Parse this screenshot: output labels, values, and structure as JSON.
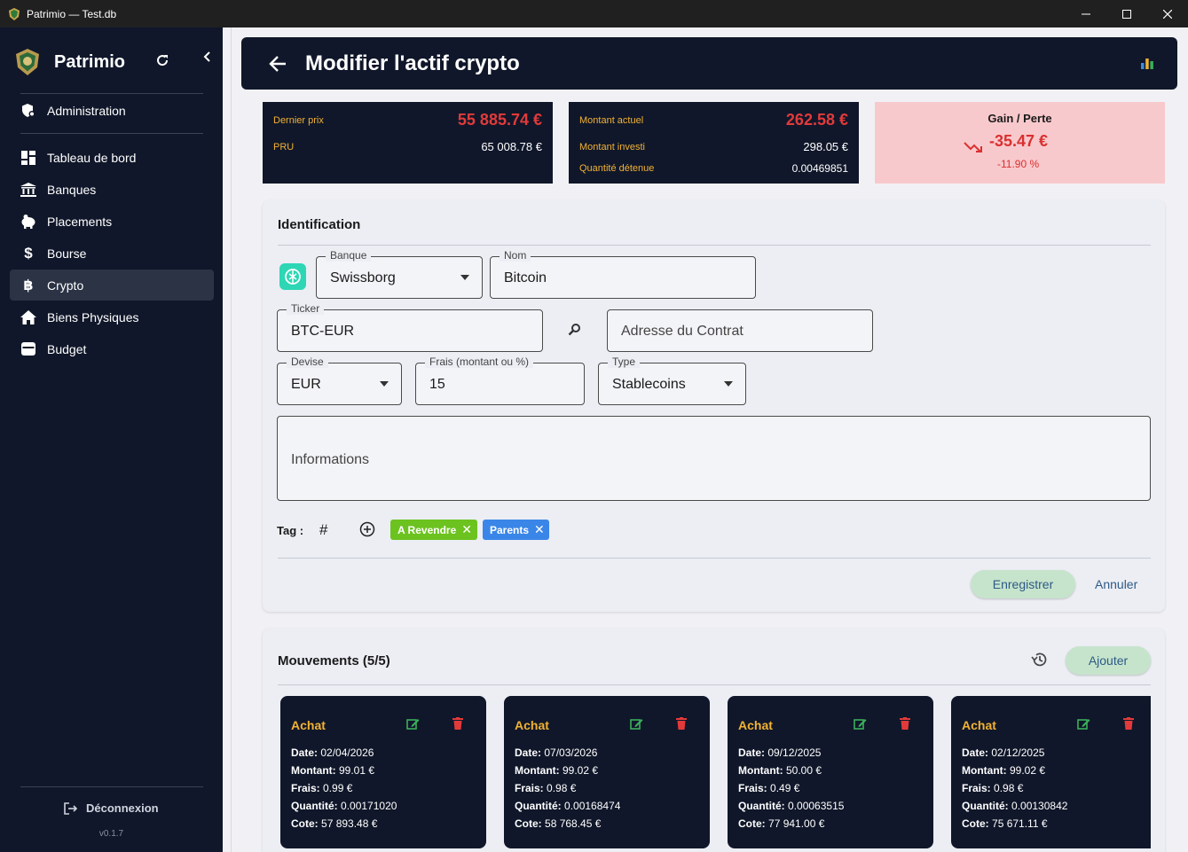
{
  "window": {
    "title": "Patrimio — Test.db"
  },
  "sidebar": {
    "brand": "Patrimio",
    "admin": "Administration",
    "items": [
      {
        "label": "Tableau de bord",
        "icon": "dashboard-icon"
      },
      {
        "label": "Banques",
        "icon": "bank-icon"
      },
      {
        "label": "Placements",
        "icon": "piggy-bank-icon"
      },
      {
        "label": "Bourse",
        "icon": "dollar-icon"
      },
      {
        "label": "Crypto",
        "icon": "bitcoin-icon",
        "active": true
      },
      {
        "label": "Biens Physiques",
        "icon": "home-icon"
      },
      {
        "label": "Budget",
        "icon": "wallet-icon"
      }
    ],
    "logout": "Déconnexion",
    "version": "v0.1.7"
  },
  "header": {
    "title": "Modifier l'actif crypto"
  },
  "stats": {
    "last_price_label": "Dernier prix",
    "last_price": "55 885.74 €",
    "pru_label": "PRU",
    "pru": "65 008.78 €",
    "current_label": "Montant actuel",
    "current": "262.58 €",
    "invested_label": "Montant investi",
    "invested": "298.05 €",
    "qty_label": "Quantité détenue",
    "qty": "0.00469851",
    "gain_title": "Gain / Perte",
    "gain_value": "-35.47 €",
    "gain_pct": "-11.90 %"
  },
  "identification": {
    "title": "Identification",
    "bank_label": "Banque",
    "bank_value": "Swissborg",
    "name_label": "Nom",
    "name_value": "Bitcoin",
    "ticker_label": "Ticker",
    "ticker_value": "BTC-EUR",
    "contract_placeholder": "Adresse du Contrat",
    "currency_label": "Devise",
    "currency_value": "EUR",
    "fees_label": "Frais (montant ou %)",
    "fees_value": "15",
    "type_label": "Type",
    "type_value": "Stablecoins",
    "info_placeholder": "Informations",
    "tag_label": "Tag :",
    "tags": [
      {
        "label": "A Revendre",
        "color": "#6cc21f"
      },
      {
        "label": "Parents",
        "color": "#3a86e8"
      }
    ],
    "save": "Enregistrer",
    "cancel": "Annuler"
  },
  "movements": {
    "title": "Mouvements (5/5)",
    "add": "Ajouter",
    "field_labels": {
      "date": "Date:",
      "amount": "Montant:",
      "fees": "Frais:",
      "qty": "Quantité:",
      "quote": "Cote:"
    },
    "cards": [
      {
        "type": "Achat",
        "date": "02/04/2026",
        "amount": "99.01 €",
        "fees": "0.99 €",
        "qty": "0.00171020",
        "quote": "57 893.48 €"
      },
      {
        "type": "Achat",
        "date": "07/03/2026",
        "amount": "99.02 €",
        "fees": "0.98 €",
        "qty": "0.00168474",
        "quote": "58 768.45 €"
      },
      {
        "type": "Achat",
        "date": "09/12/2025",
        "amount": "50.00 €",
        "fees": "0.49 €",
        "qty": "0.00063515",
        "quote": "77 941.00 €"
      },
      {
        "type": "Achat",
        "date": "02/12/2025",
        "amount": "99.02 €",
        "fees": "0.98 €",
        "qty": "0.00130842",
        "quote": "75 671.11 €"
      }
    ]
  }
}
